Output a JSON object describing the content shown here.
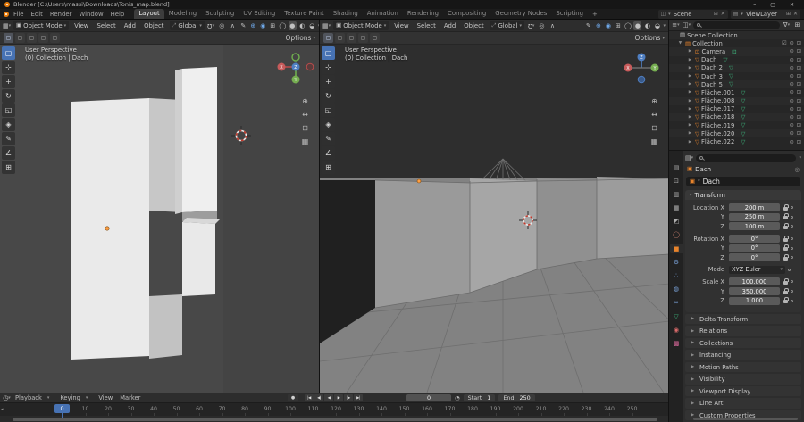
{
  "titlebar": {
    "title": "Blender [C:\\Users\\massi\\Downloads\\Tonis_map.blend]",
    "minimize": "–",
    "maximize": "▢",
    "close": "✕"
  },
  "topbar": {
    "menus": [
      "File",
      "Edit",
      "Render",
      "Window",
      "Help"
    ],
    "workspaces": [
      "Layout",
      "Modeling",
      "Sculpting",
      "UV Editing",
      "Texture Paint",
      "Shading",
      "Animation",
      "Rendering",
      "Compositing",
      "Geometry Nodes",
      "Scripting"
    ],
    "active_workspace": "Layout",
    "add_tab": "+",
    "scene_label": "Scene",
    "view_layer_label": "ViewLayer"
  },
  "viewport_header": {
    "mode": "Object Mode",
    "menus": [
      "View",
      "Select",
      "Add",
      "Object"
    ],
    "orientation": "Global",
    "options": "Options",
    "right_icons": [
      "annotate",
      "gizmos",
      "overlays",
      "xray",
      "shading-wireframe",
      "shading-solid",
      "shading-material",
      "shading-rendered"
    ]
  },
  "viewport_overlay": {
    "line1": "User Perspective",
    "line2": "(0) Collection | Dach"
  },
  "toolbar_tools": [
    "select-box",
    "cursor",
    "move",
    "rotate",
    "scale",
    "transform",
    "annotate",
    "measure",
    "add-cube"
  ],
  "nav_icons": [
    "zoom",
    "pan",
    "camera",
    "ortho"
  ],
  "outliner": {
    "root": "Scene Collection",
    "collection": "Collection",
    "items": [
      "Camera",
      "Dach",
      "Dach 2",
      "Dach 3",
      "Dach 5",
      "Fläche.001",
      "Fläche.008",
      "Fläche.017",
      "Fläche.018",
      "Fläche.019",
      "Fläche.020",
      "Fläche.022"
    ]
  },
  "properties": {
    "breadcrumb": "Dach",
    "object_name": "Dach",
    "transform_label": "Transform",
    "transform_groups": [
      {
        "rows": [
          {
            "label": "Location X",
            "value": "200 m"
          },
          {
            "label": "Y",
            "value": "250 m"
          },
          {
            "label": "Z",
            "value": "100 m"
          }
        ]
      },
      {
        "rows": [
          {
            "label": "Rotation X",
            "value": "0°"
          },
          {
            "label": "Y",
            "value": "0°"
          },
          {
            "label": "Z",
            "value": "0°"
          }
        ]
      },
      {
        "rows": [
          {
            "label": "Mode",
            "value": "XYZ Euler",
            "dropdown": true
          }
        ]
      },
      {
        "rows": [
          {
            "label": "Scale X",
            "value": "100.000"
          },
          {
            "label": "Y",
            "value": "350.000"
          },
          {
            "label": "Z",
            "value": "1.000"
          }
        ]
      }
    ],
    "sections": [
      "Delta Transform",
      "Relations",
      "Collections",
      "Instancing",
      "Motion Paths",
      "Visibility",
      "Viewport Display",
      "Line Art",
      "Custom Properties"
    ],
    "tabs": [
      "tool",
      "render",
      "output",
      "view-layer",
      "scene",
      "world",
      "object",
      "modifiers",
      "particles",
      "physics",
      "constraints",
      "object-data",
      "material",
      "texture"
    ],
    "active_tab": "object"
  },
  "timeline": {
    "menus": [
      "Playback",
      "Keying",
      "View",
      "Marker"
    ],
    "playback_buttons": [
      "jump-start",
      "prev-keyframe",
      "play-reverse",
      "play",
      "next-keyframe",
      "jump-end"
    ],
    "current_frame": "0",
    "start_label": "Start",
    "start_value": "1",
    "end_label": "End",
    "end_value": "250",
    "ticks": [
      0,
      10,
      20,
      30,
      40,
      50,
      60,
      70,
      80,
      90,
      100,
      110,
      120,
      130,
      140,
      150,
      160,
      170,
      180,
      190,
      200,
      210,
      220,
      230,
      240,
      250
    ]
  },
  "colors": {
    "accent_blue": "#4772b3",
    "object_orange": "#e8842c",
    "mesh_data_green": "#3db87e"
  }
}
